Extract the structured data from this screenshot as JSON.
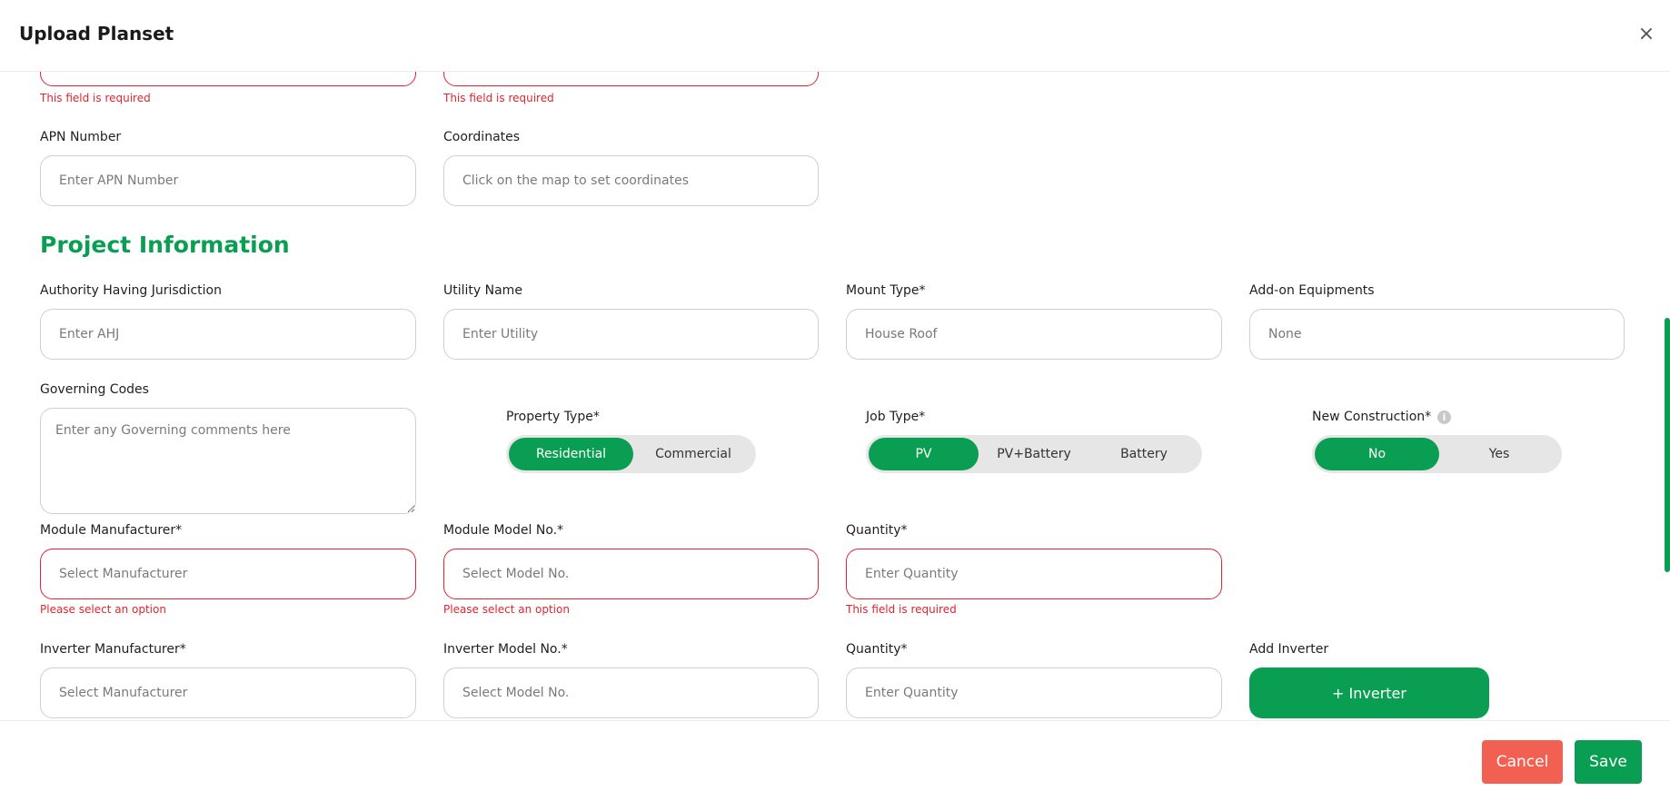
{
  "header": {
    "title": "Upload Planset",
    "close_glyph": "×"
  },
  "top_errors": {
    "left": "This field is required",
    "right": "This field is required"
  },
  "apn": {
    "label": "APN Number",
    "placeholder": "Enter APN Number"
  },
  "coordinates": {
    "label": "Coordinates",
    "placeholder": "Click on the map to set coordinates"
  },
  "section": {
    "title": "Project Information"
  },
  "ahj": {
    "label": "Authority Having Jurisdiction",
    "placeholder": "Enter AHJ"
  },
  "utility": {
    "label": "Utility Name",
    "placeholder": "Enter Utility"
  },
  "mount": {
    "label": "Mount Type*",
    "value": "House Roof"
  },
  "addon": {
    "label": "Add-on Equipments",
    "value": "None"
  },
  "governing": {
    "label": "Governing Codes",
    "placeholder": "Enter any Governing comments here"
  },
  "property_type": {
    "label": "Property Type*",
    "options": [
      "Residential",
      "Commercial"
    ],
    "selected": "Residential"
  },
  "job_type": {
    "label": "Job Type*",
    "options": [
      "PV",
      "PV+Battery",
      "Battery"
    ],
    "selected": "PV"
  },
  "new_construction": {
    "label": "New Construction*",
    "info_glyph": "i",
    "options": [
      "No",
      "Yes"
    ],
    "selected": "No"
  },
  "module_manufacturer": {
    "label": "Module Manufacturer*",
    "placeholder": "Select Manufacturer",
    "error": "Please select an option"
  },
  "module_model": {
    "label": "Module Model No.*",
    "placeholder": "Select Model No.",
    "error": "Please select an option"
  },
  "module_quantity": {
    "label": "Quantity*",
    "placeholder": "Enter Quantity",
    "error": "This field is required"
  },
  "inverter_manufacturer": {
    "label": "Inverter Manufacturer*",
    "placeholder": "Select Manufacturer"
  },
  "inverter_model": {
    "label": "Inverter Model No.*",
    "placeholder": "Select Model No."
  },
  "inverter_quantity": {
    "label": "Quantity*",
    "placeholder": "Enter Quantity"
  },
  "add_inverter": {
    "label": "Add Inverter",
    "button": "+ Inverter"
  },
  "footer": {
    "cancel": "Cancel",
    "save": "Save"
  },
  "colors": {
    "brand_green": "#0a9e52",
    "error_red": "#e0252f",
    "cancel_red": "#f26052"
  }
}
